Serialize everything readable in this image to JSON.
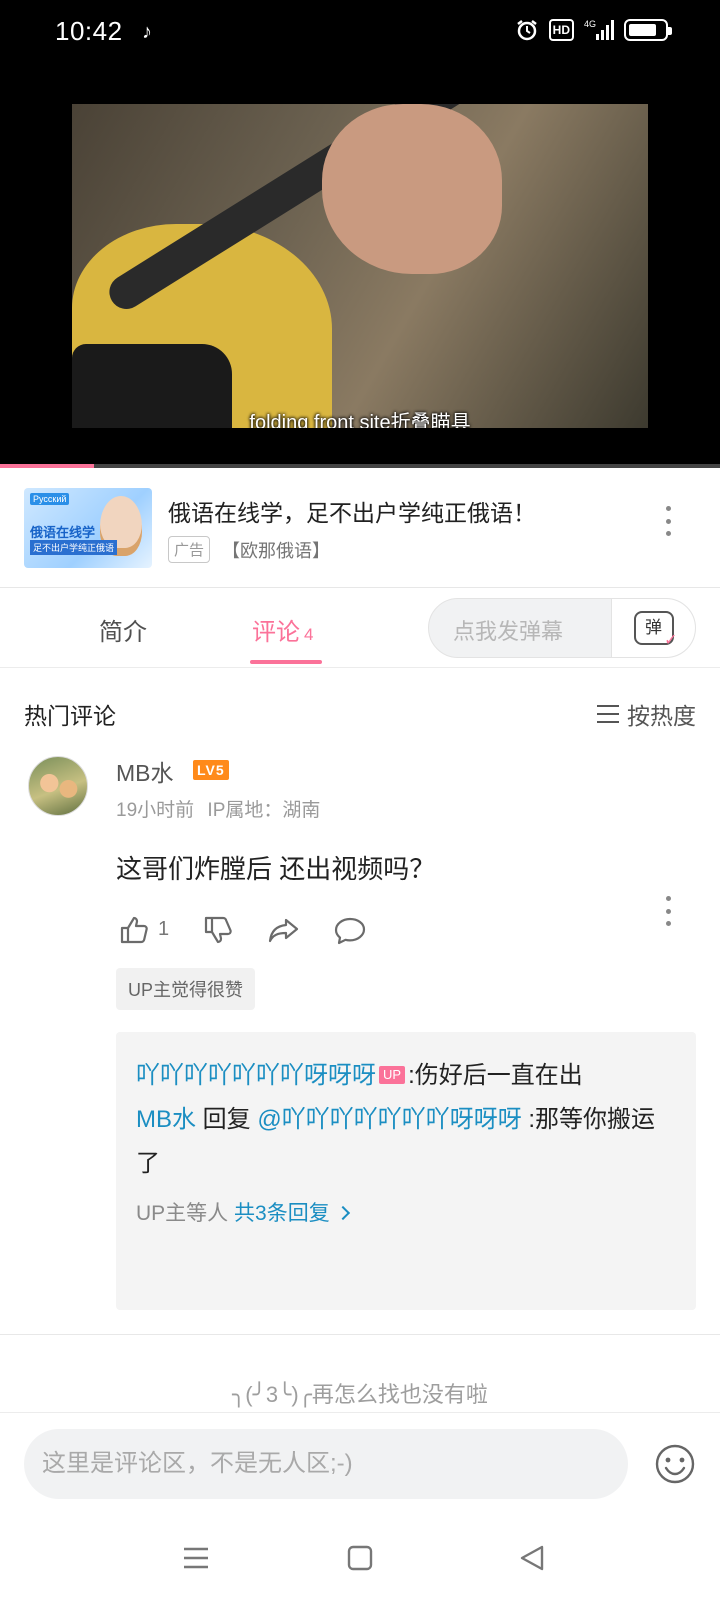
{
  "status_bar": {
    "time": "10:42",
    "hd_label": "HD",
    "network_label": "4G",
    "battery_level": 0.8
  },
  "video": {
    "subtitle": "folding front site折叠瞄具",
    "progress": 0.13
  },
  "ad": {
    "thumb_brand": "Русский",
    "thumb_title": "俄语在线学",
    "thumb_sub": "足不出户学纯正俄语",
    "title": "俄语在线学，足不出户学纯正俄语！",
    "tag": "广告",
    "source": "【欧那俄语】"
  },
  "tabs": {
    "intro": "简介",
    "comments": "评论",
    "comment_count": "4",
    "danmaku_placeholder": "点我发弹幕",
    "danmaku_icon_char": "弹"
  },
  "comments_header": {
    "title": "热门评论",
    "sort_label": "按热度"
  },
  "comment": {
    "username": "MB水",
    "level": "LV5",
    "time": "19小时前",
    "ip": "IP属地：湖南",
    "text": "这哥们炸膛后 还出视频吗？",
    "like_count": "1",
    "up_liked": "UP主觉得很赞",
    "replies": [
      {
        "author": "吖吖吖吖吖吖吖呀呀呀",
        "badge": "UP",
        "text": ":伤好后一直在出"
      },
      {
        "author": "MB水",
        "reply_word": " 回复 ",
        "mention": "@吖吖吖吖吖吖吖呀呀呀",
        "text": " :那等你搬运了"
      }
    ],
    "reply_footer_prefix": "UP主等人 ",
    "reply_footer_link": "共3条回复"
  },
  "end_text": "╮(╯3╰)╭再怎么找也没有啦",
  "input": {
    "placeholder": "这里是评论区，不是无人区;-)"
  }
}
